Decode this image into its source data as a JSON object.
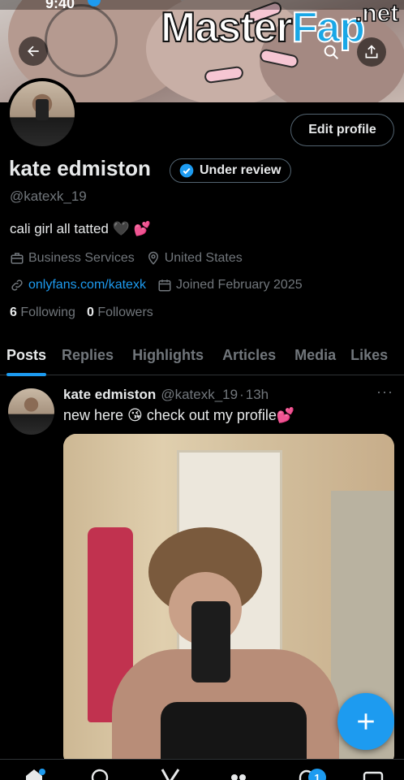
{
  "status": {
    "time": "9:40"
  },
  "watermark": {
    "master": "Master",
    "fap": "Fap",
    "net": ".net"
  },
  "header": {
    "edit_profile_label": "Edit profile"
  },
  "profile": {
    "name": "kate edmiston",
    "badge_label": "Under review",
    "handle": "@katexk_19",
    "bio": "cali girl all tatted 🖤 💕",
    "category": "Business Services",
    "location": "United States",
    "link": "onlyfans.com/katexk",
    "joined": "Joined February 2025",
    "following_count": "6",
    "following_label": "Following",
    "followers_count": "0",
    "followers_label": "Followers"
  },
  "tabs": [
    {
      "label": "Posts",
      "active": true
    },
    {
      "label": "Replies"
    },
    {
      "label": "Highlights"
    },
    {
      "label": "Articles"
    },
    {
      "label": "Media"
    },
    {
      "label": "Likes"
    }
  ],
  "post": {
    "author_name": "kate edmiston",
    "author_handle": "@katexk_19",
    "separator": "·",
    "time": "13h",
    "more": "···",
    "text": "new here 😘 check out my profile💕"
  },
  "bottom_nav": {
    "notifications_badge": "1"
  },
  "colors": {
    "accent": "#1d9bf0",
    "background": "#000000",
    "muted": "#71767b",
    "text": "#e7e9ea"
  },
  "icons": [
    "back-arrow-icon",
    "search-icon",
    "share-icon",
    "verified-badge-icon",
    "briefcase-icon",
    "location-pin-icon",
    "link-icon",
    "calendar-icon",
    "plus-icon",
    "home-icon",
    "explore-icon",
    "grok-icon",
    "communities-icon",
    "notifications-icon",
    "messages-icon"
  ]
}
